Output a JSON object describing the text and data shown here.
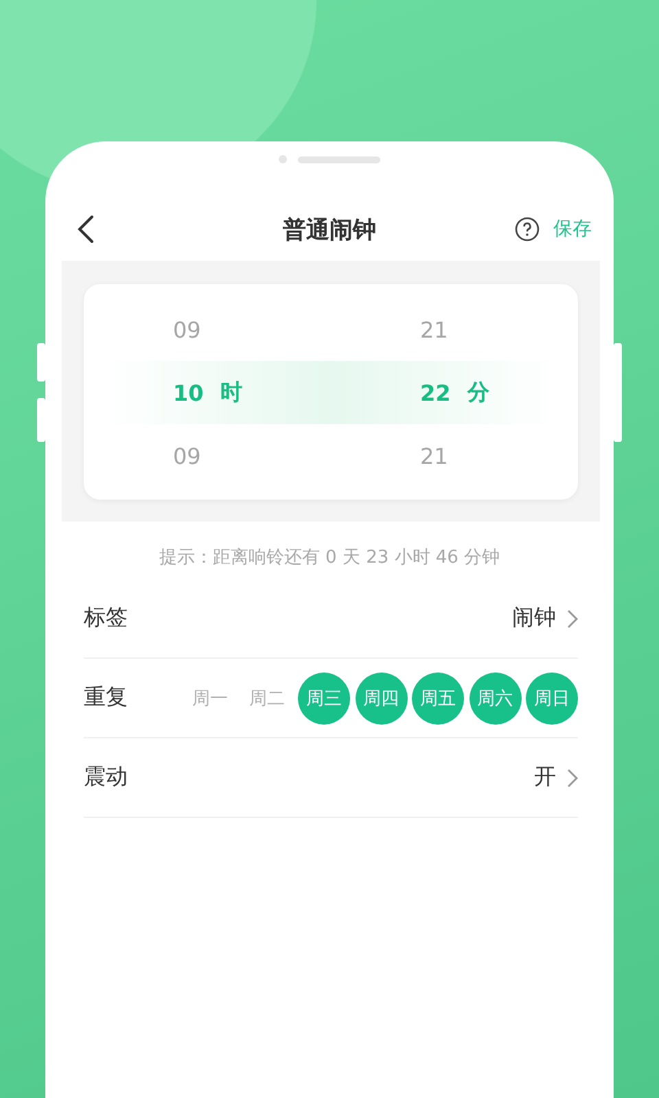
{
  "header": {
    "title": "普通闹钟",
    "action": "保存"
  },
  "picker": {
    "columns": [
      {
        "above": "09",
        "value": "10",
        "unit": "时",
        "below": "09"
      },
      {
        "above": "21",
        "value": "22",
        "unit": "分",
        "below": "21"
      }
    ]
  },
  "hint": "提示：距离响铃还有 0 天 23 小时 46 分钟",
  "rows": [
    {
      "kind": "link",
      "label": "标签",
      "value": "闹钟"
    },
    {
      "kind": "days",
      "label": "重复",
      "days": [
        {
          "label": "周一",
          "selected": false
        },
        {
          "label": "周二",
          "selected": false
        },
        {
          "label": "周三",
          "selected": true
        },
        {
          "label": "周四",
          "selected": true
        },
        {
          "label": "周五",
          "selected": true
        },
        {
          "label": "周六",
          "selected": true
        },
        {
          "label": "周日",
          "selected": true
        }
      ]
    },
    {
      "kind": "link",
      "label": "震动",
      "value": "开"
    }
  ]
}
